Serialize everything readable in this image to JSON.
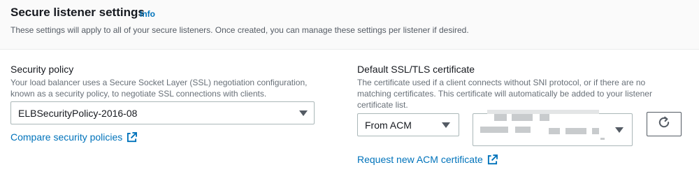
{
  "header": {
    "title": "Secure listener settings",
    "info_link": "Info",
    "subtitle": "These settings will apply to all of your secure listeners. Once created, you can manage these settings per listener if desired."
  },
  "security_policy": {
    "label": "Security policy",
    "description_line1": "Your load balancer uses a Secure Socket Layer (SSL) negotiation configuration,",
    "description_line2": "known as a security policy, to negotiate SSL connections with clients.",
    "selected_value": "ELBSecurityPolicy-2016-08",
    "compare_link": "Compare security policies"
  },
  "certificate": {
    "label": "Default SSL/TLS certificate",
    "description_line1": "The certificate used if a client connects without SNI protocol, or if there are no",
    "description_line2": "matching certificates. This certificate will automatically be added to your listener",
    "description_line3": "certificate list.",
    "source_selected": "From ACM",
    "request_link": "Request new ACM certificate"
  },
  "icons": {
    "external": "external-link-icon",
    "dropdown": "caret-down-icon",
    "refresh": "refresh-icon"
  },
  "colors": {
    "link": "#0073bb",
    "text": "#16191f",
    "muted": "#687078",
    "border": "#aab7b8"
  }
}
